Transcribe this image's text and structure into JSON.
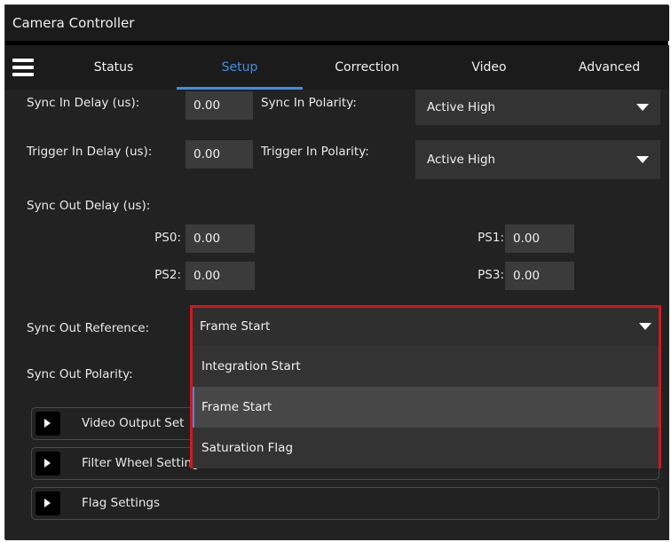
{
  "window": {
    "title": "Camera Controller"
  },
  "nav": {
    "menu_icon": "hamburger-menu-icon",
    "tabs": [
      {
        "label": "Status",
        "active": false
      },
      {
        "label": "Setup",
        "active": true
      },
      {
        "label": "Correction",
        "active": false
      },
      {
        "label": "Video",
        "active": false
      },
      {
        "label": "Advanced",
        "active": false
      }
    ]
  },
  "setup": {
    "sync_in_delay": {
      "label": "Sync In Delay (us):",
      "value": "0.00"
    },
    "sync_in_polarity": {
      "label": "Sync In Polarity:",
      "value": "Active High"
    },
    "trigger_in_delay": {
      "label": "Trigger In Delay (us):",
      "value": "0.00"
    },
    "trigger_in_polarity": {
      "label": "Trigger In Polarity:",
      "value": "Active High"
    },
    "sync_out_delay": {
      "label": "Sync Out Delay (us):",
      "ps0": {
        "label": "PS0:",
        "value": "0.00"
      },
      "ps1": {
        "label": "PS1:",
        "value": "0.00"
      },
      "ps2": {
        "label": "PS2:",
        "value": "0.00"
      },
      "ps3": {
        "label": "PS3:",
        "value": "0.00"
      }
    },
    "sync_out_reference": {
      "label": "Sync Out Reference:",
      "value": "Frame Start",
      "options": [
        "Integration Start",
        "Frame Start",
        "Saturation Flag"
      ],
      "highlighted": "Frame Start"
    },
    "sync_out_polarity": {
      "label": "Sync Out Polarity:"
    }
  },
  "sections": [
    {
      "label": "Video Output Settings",
      "visible_label": "Video Output Set"
    },
    {
      "label": "Filter Wheel Settings",
      "visible_label": "Filter Wheel Settings"
    },
    {
      "label": "Flag Settings",
      "visible_label": "Flag Settings"
    }
  ],
  "colors": {
    "accent": "#3d8ee6",
    "highlight_border": "#d0191f",
    "panel_bg": "#222222",
    "field_bg": "#3b3b3b"
  }
}
